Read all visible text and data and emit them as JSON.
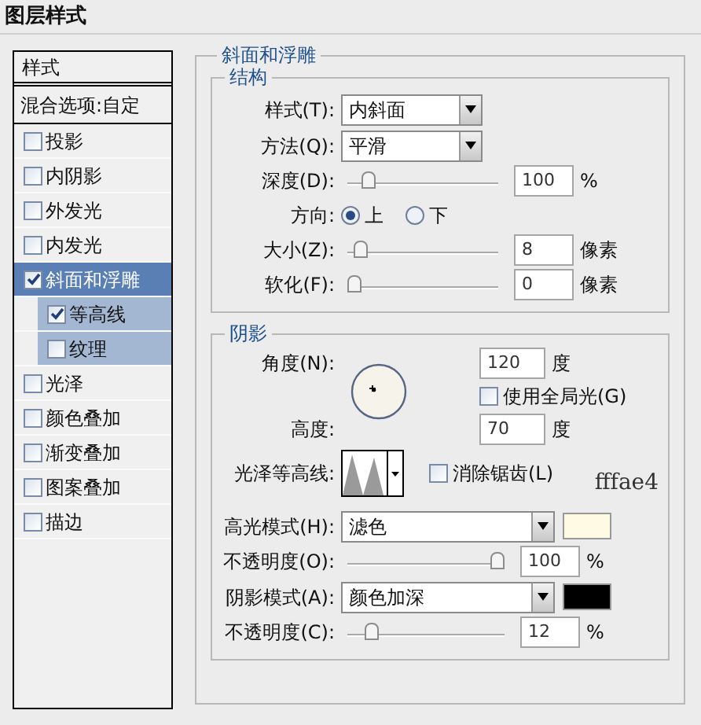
{
  "title": "图层样式",
  "sidebar": {
    "header": "样式",
    "blend_options": "混合选项:自定",
    "items": [
      {
        "label": "投影",
        "checked": false,
        "selected": false
      },
      {
        "label": "内阴影",
        "checked": false,
        "selected": false
      },
      {
        "label": "外发光",
        "checked": false,
        "selected": false
      },
      {
        "label": "内发光",
        "checked": false,
        "selected": false
      },
      {
        "label": "斜面和浮雕",
        "checked": true,
        "selected": true,
        "children": [
          {
            "label": "等高线",
            "checked": true,
            "selected": false
          },
          {
            "label": "纹理",
            "checked": false,
            "selected": false
          }
        ]
      },
      {
        "label": "光泽",
        "checked": false,
        "selected": false
      },
      {
        "label": "颜色叠加",
        "checked": false,
        "selected": false
      },
      {
        "label": "渐变叠加",
        "checked": false,
        "selected": false
      },
      {
        "label": "图案叠加",
        "checked": false,
        "selected": false
      },
      {
        "label": "描边",
        "checked": false,
        "selected": false
      }
    ]
  },
  "bevel": {
    "title": "斜面和浮雕",
    "structure": {
      "title": "结构",
      "rows": [
        {
          "kind": "select",
          "label": "样式(T):",
          "value": "内斜面"
        },
        {
          "kind": "select",
          "label": "方法(Q):",
          "value": "平滑"
        },
        {
          "kind": "slider",
          "label": "深度(D):",
          "level": 0.1,
          "value": "100",
          "unit": "%"
        },
        {
          "kind": "radio",
          "label": "方向:",
          "options": [
            {
              "label": "上",
              "selected": true
            },
            {
              "label": "下",
              "selected": false
            }
          ]
        },
        {
          "kind": "slider",
          "label": "大小(Z):",
          "level": 0.05,
          "value": "8",
          "unit": "像素"
        },
        {
          "kind": "slider",
          "label": "软化(F):",
          "level": 0,
          "value": "0",
          "unit": "像素"
        }
      ]
    },
    "shading": {
      "title": "阴影",
      "angle_label": "角度(N):",
      "angle": "120",
      "angle_unit": "度",
      "global_light": {
        "label": "使用全局光(G)",
        "checked": false
      },
      "altitude_label": "高度:",
      "altitude": "70",
      "altitude_unit": "度",
      "contour_label": "光泽等高线:",
      "anti_alias": {
        "label": "消除锯齿(L)",
        "checked": false
      },
      "note": "fffae4",
      "rows": [
        {
          "kind": "mode",
          "label": "高光模式(H):",
          "value": "滤色",
          "color": "#fffae4"
        },
        {
          "kind": "slider",
          "label": "不透明度(O):",
          "level": 1,
          "value": "100",
          "unit": "%"
        },
        {
          "kind": "mode",
          "label": "阴影模式(A):",
          "value": "颜色加深",
          "color": "#000000"
        },
        {
          "kind": "slider",
          "label": "不透明度(C):",
          "level": 0.12,
          "value": "12",
          "unit": "%"
        }
      ]
    }
  }
}
